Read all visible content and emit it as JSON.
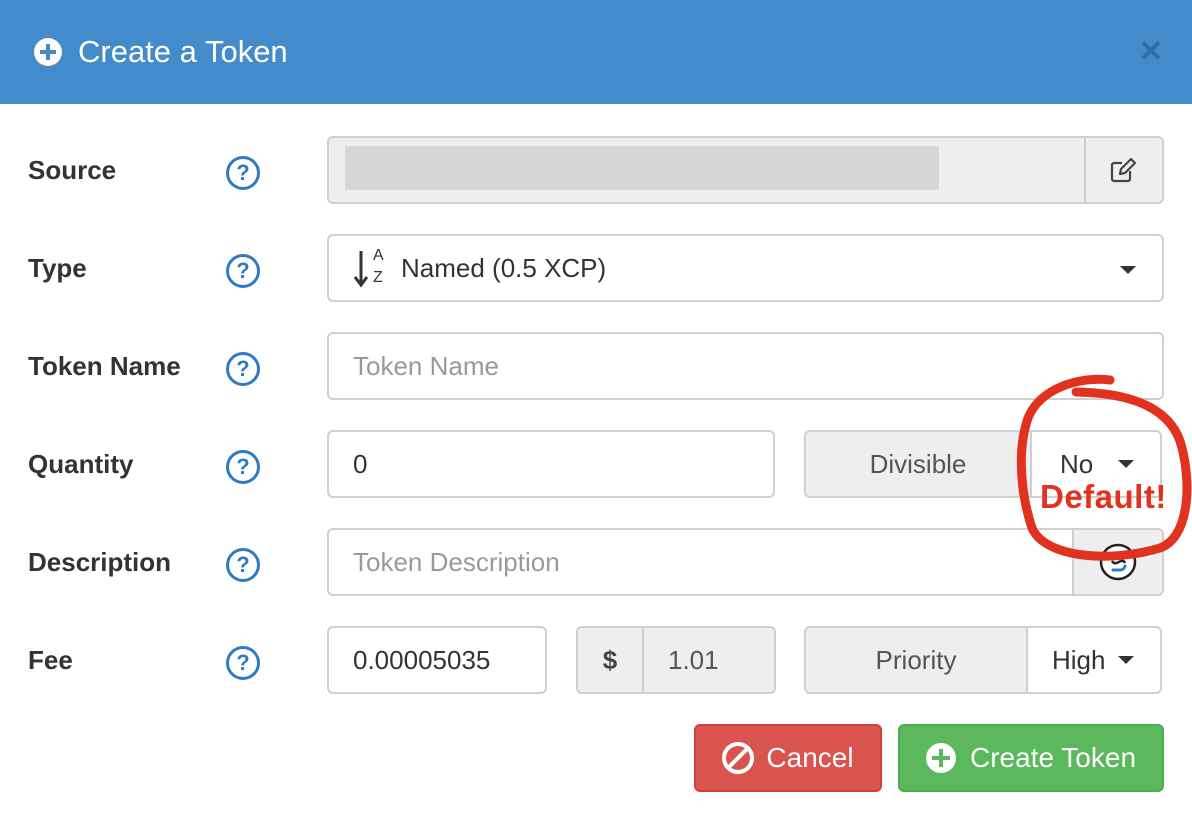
{
  "header": {
    "title": "Create a Token",
    "close": "×"
  },
  "help_glyph": "?",
  "rows": {
    "source": {
      "label": "Source"
    },
    "type": {
      "label": "Type",
      "value": "Named (0.5 XCP)",
      "sort_top": "A",
      "sort_bottom": "Z"
    },
    "token_name": {
      "label": "Token Name",
      "placeholder": "Token Name"
    },
    "quantity": {
      "label": "Quantity",
      "value": "0",
      "divisible_label": "Divisible",
      "divisible_value": "No"
    },
    "description": {
      "label": "Description",
      "placeholder": "Token Description"
    },
    "fee": {
      "label": "Fee",
      "value": "0.00005035",
      "currency": "$",
      "usd": "1.01",
      "priority_label": "Priority",
      "priority_value": "High"
    }
  },
  "buttons": {
    "cancel": "Cancel",
    "create": "Create Token"
  },
  "annotation": {
    "text": "Default!",
    "color": "#e0321e"
  },
  "colors": {
    "header": "#438bcb",
    "cancel": "#d9534f",
    "create": "#5cb85c",
    "help": "#2e7bc4"
  }
}
